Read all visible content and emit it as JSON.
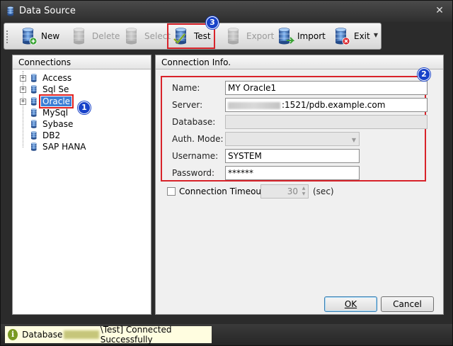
{
  "window": {
    "title": "Data Source"
  },
  "toolbar": {
    "buttons": [
      {
        "label": "New",
        "enabled": true
      },
      {
        "label": "Delete",
        "enabled": false
      },
      {
        "label": "Select",
        "enabled": false
      },
      {
        "label": "Test",
        "enabled": true
      },
      {
        "label": "Export",
        "enabled": false
      },
      {
        "label": "Import",
        "enabled": true
      },
      {
        "label": "Exit",
        "enabled": true
      }
    ]
  },
  "connections": {
    "title": "Connections",
    "items": [
      {
        "label": "Access",
        "expandable": true
      },
      {
        "label": "Sql Se",
        "expandable": true
      },
      {
        "label": "Oracle",
        "expandable": true,
        "selected": true
      },
      {
        "label": "MySql",
        "expandable": false
      },
      {
        "label": "Sybase",
        "expandable": false
      },
      {
        "label": "DB2",
        "expandable": false
      },
      {
        "label": "SAP HANA",
        "expandable": false
      }
    ]
  },
  "connection_info": {
    "title": "Connection Info.",
    "fields": {
      "name": {
        "label": "Name:",
        "value": "MY Oracle1"
      },
      "server": {
        "label": "Server:",
        "value": ":1521/pdb.example.com"
      },
      "database": {
        "label": "Database:",
        "value": ""
      },
      "auth_mode": {
        "label": "Auth. Mode:",
        "value": ""
      },
      "username": {
        "label": "Username:",
        "value": "SYSTEM"
      },
      "password": {
        "label": "Password:",
        "value": "******"
      }
    },
    "timeout": {
      "label": "Connection Timeout:",
      "value": "30",
      "unit": "(sec)",
      "checked": false
    }
  },
  "buttons": {
    "ok": "OK",
    "cancel": "Cancel"
  },
  "badges": {
    "one": "1",
    "two": "2",
    "three": "3"
  },
  "status": {
    "prefix": "Database",
    "suffix": "\\Test] Connected Successfully",
    "icon": "info-icon"
  },
  "colors": {
    "highlight": "#d8232a",
    "badge": "#1842c9",
    "selection": "#3d7fd6",
    "status_bg": "#fffde0"
  }
}
